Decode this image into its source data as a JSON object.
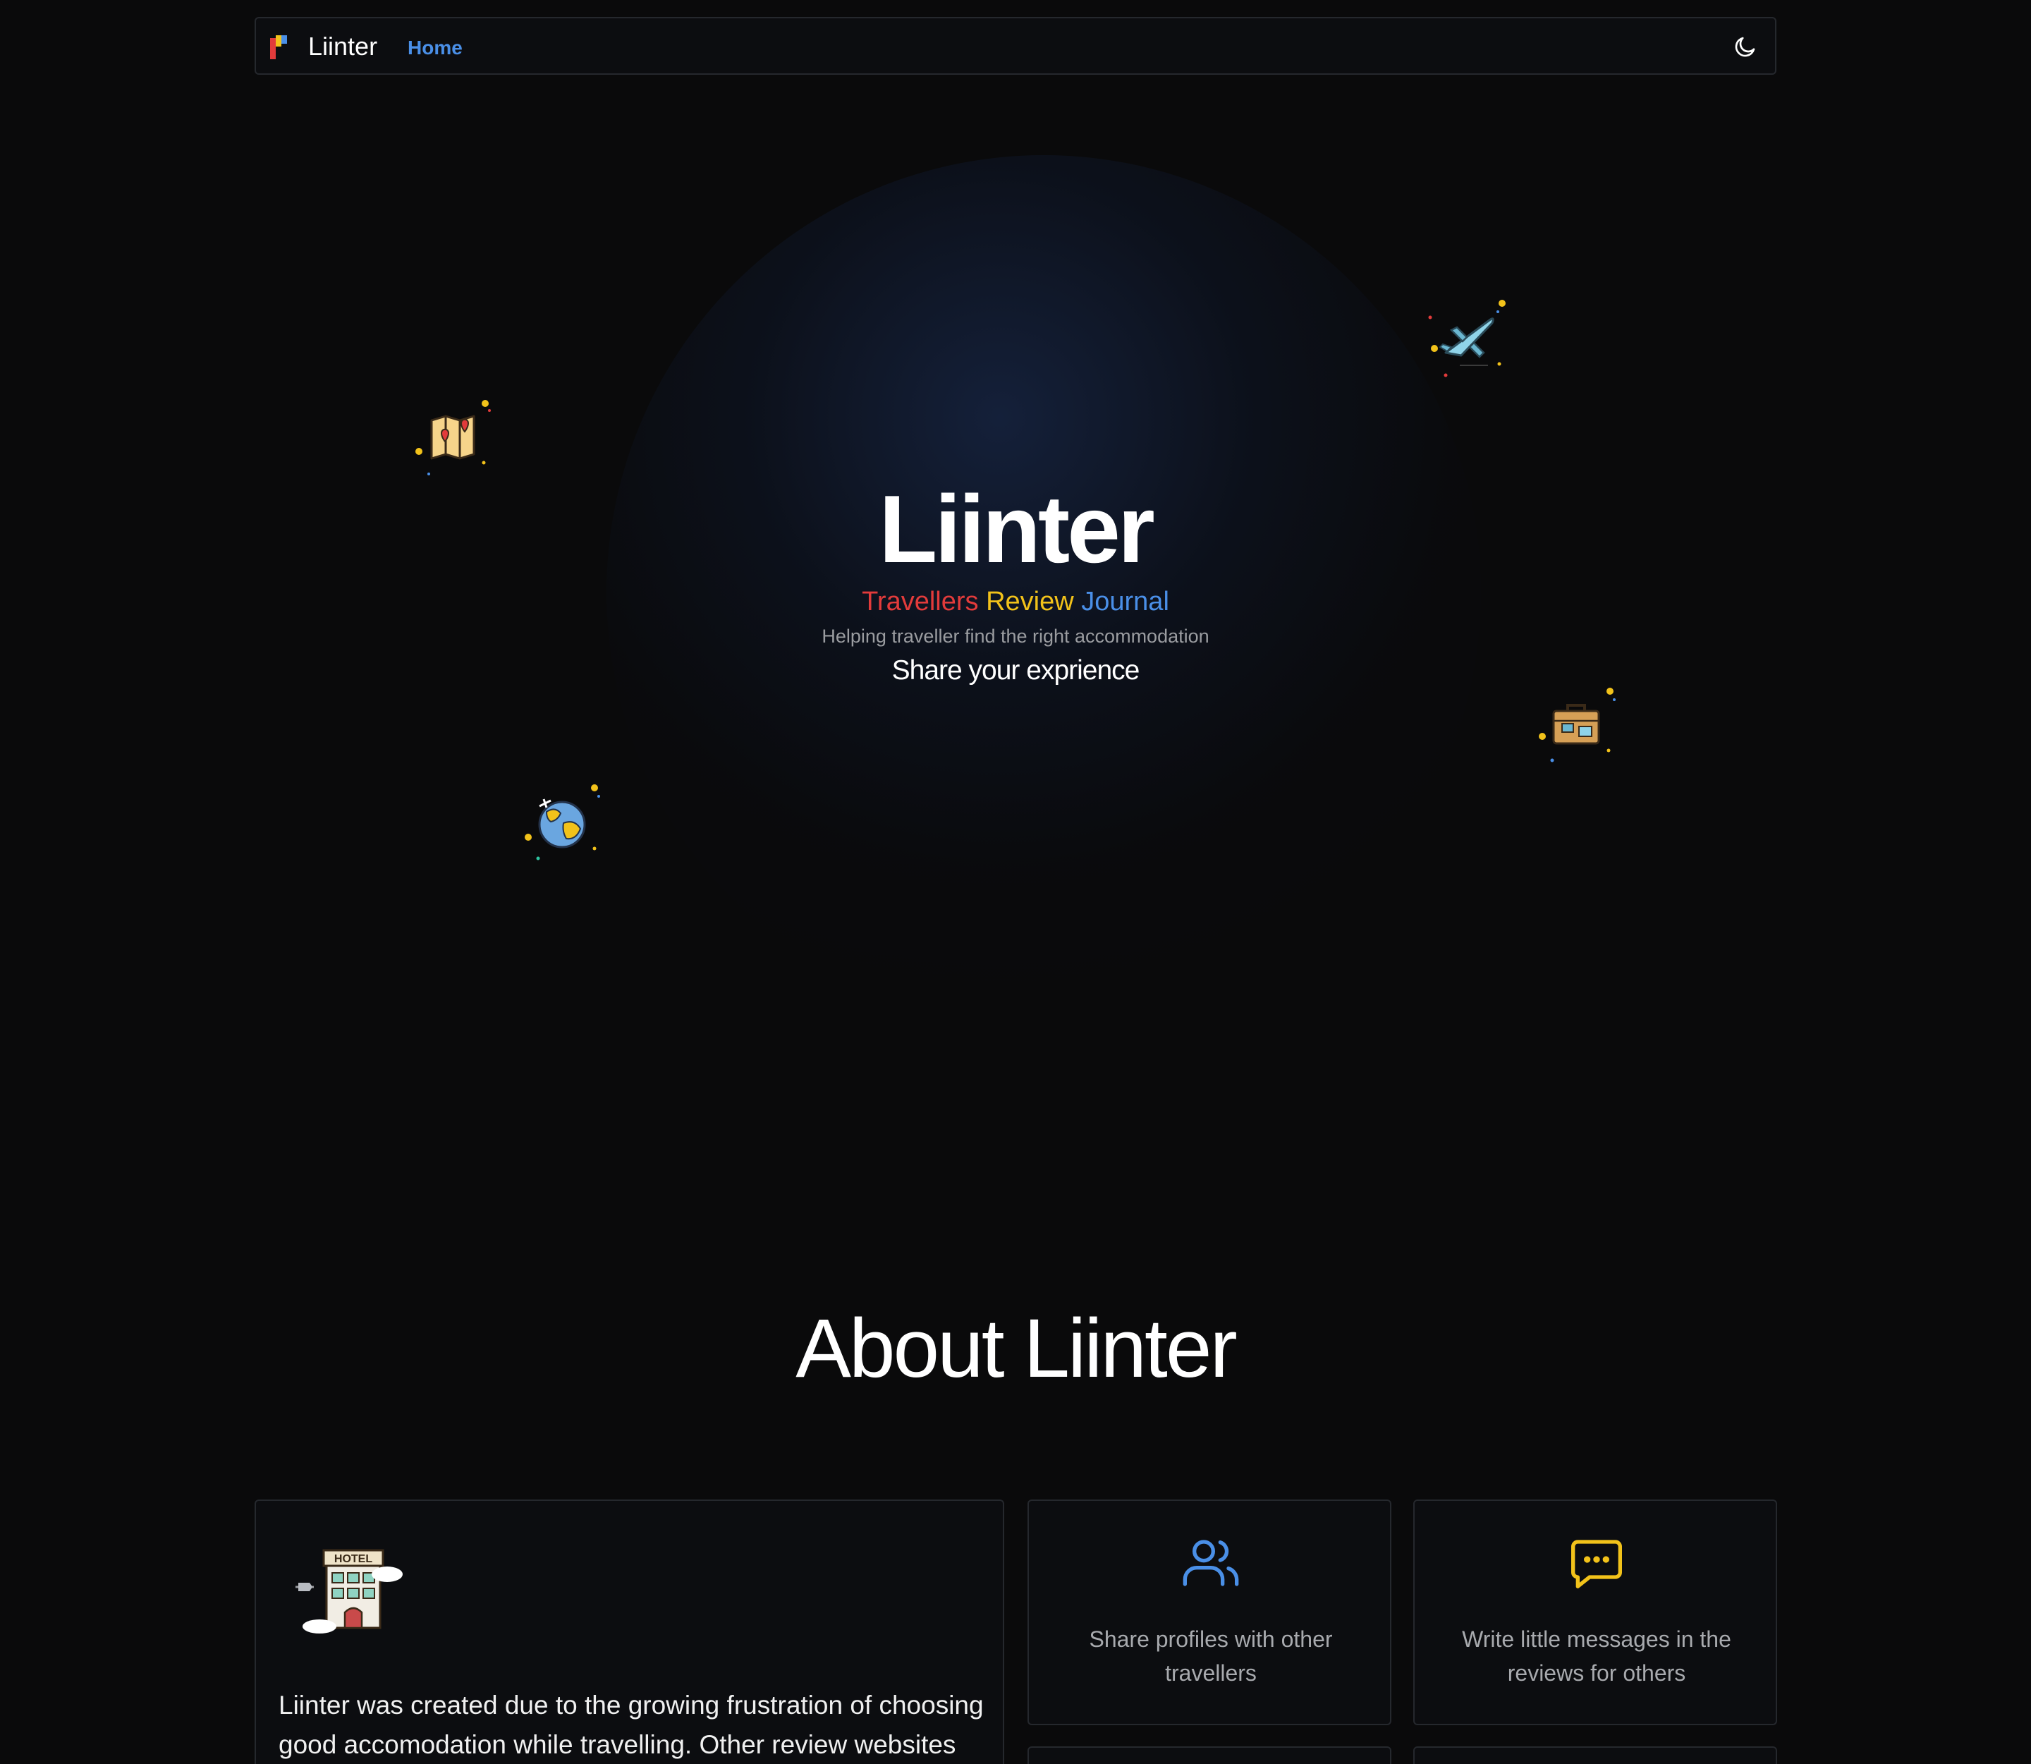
{
  "navbar": {
    "brand": "Liinter",
    "home_link": "Home",
    "theme_toggle_icon": "moon-icon"
  },
  "hero": {
    "title": "Liinter",
    "tagline": {
      "word1": "Travellers",
      "word2": "Review",
      "word3": "Journal"
    },
    "subtitle": "Helping traveller find the right accommodation",
    "cta_text": "Share your exprience",
    "decorations": [
      "map-icon",
      "airplane-icon",
      "globe-icon",
      "suitcase-icon"
    ]
  },
  "about": {
    "title": "About Liinter",
    "main_card": {
      "icon": "hotel-icon",
      "text": "Liinter was created due to the growing frustration of choosing good accomodation while travelling. Other review websites"
    },
    "features": [
      {
        "icon": "users-icon",
        "text": "Share profiles with other travellers"
      },
      {
        "icon": "message-icon",
        "text": "Write little messages in the reviews for others"
      }
    ]
  },
  "colors": {
    "background": "#0a0a0b",
    "accent_blue": "#4a8fe7",
    "accent_red": "#e23b3b",
    "accent_yellow": "#f2c21a",
    "card_border": "#25282d"
  }
}
